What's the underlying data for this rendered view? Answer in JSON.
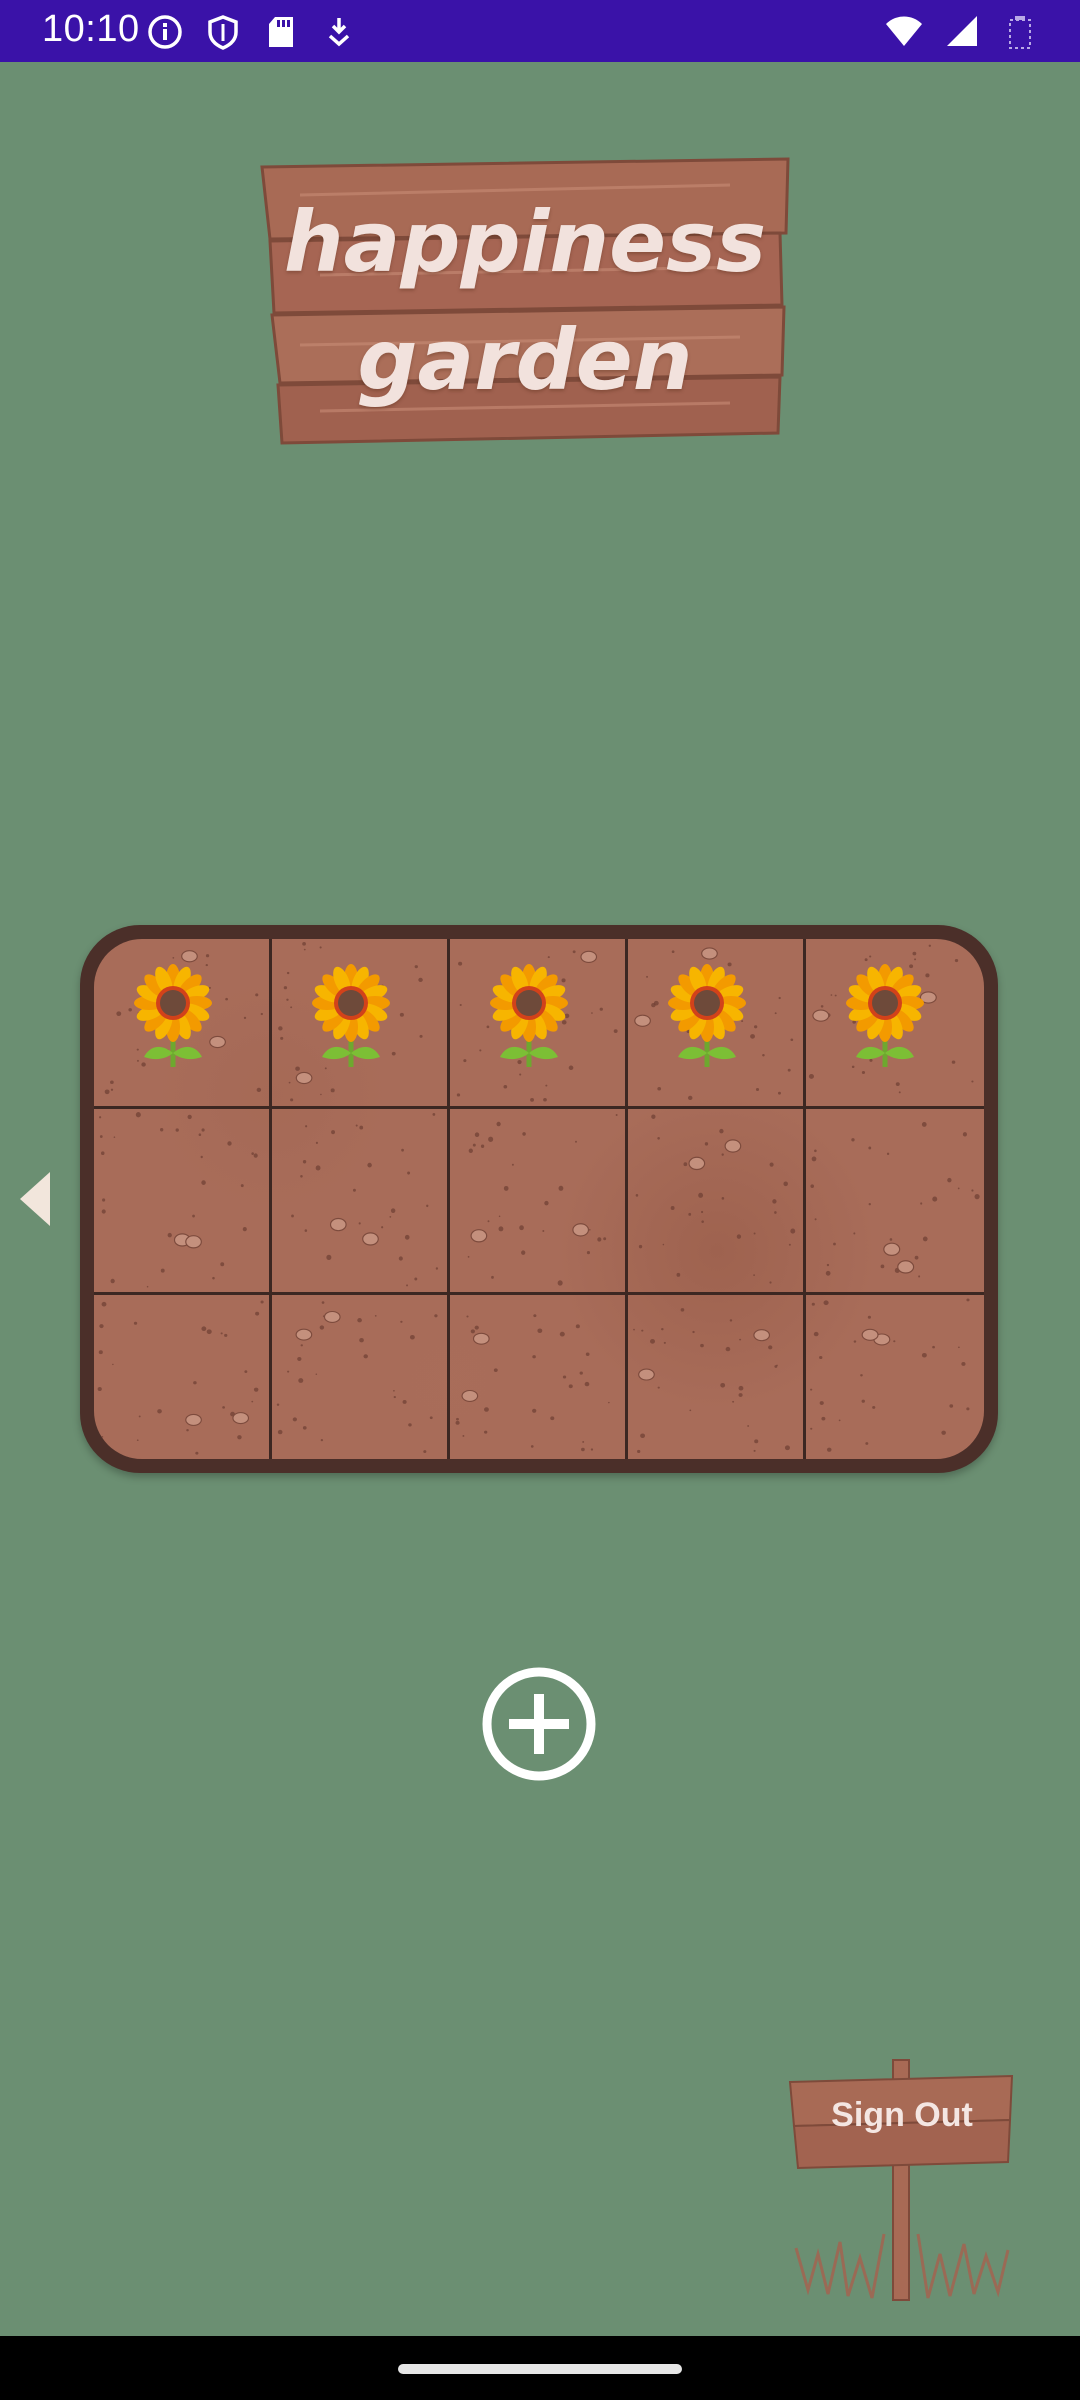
{
  "status_bar": {
    "time": "10:10",
    "left_icons": [
      "info-icon",
      "shield-icon",
      "sd-card-icon",
      "download-icon"
    ],
    "right_icons": [
      "wifi-icon",
      "cell-signal-icon",
      "battery-icon"
    ]
  },
  "title": {
    "line1": "happiness",
    "line2": "garden"
  },
  "garden": {
    "rows": 3,
    "columns": 5,
    "plants": [
      {
        "row": 1,
        "col": 1,
        "type": "sunflower"
      },
      {
        "row": 1,
        "col": 2,
        "type": "sunflower"
      },
      {
        "row": 1,
        "col": 3,
        "type": "sunflower"
      },
      {
        "row": 1,
        "col": 4,
        "type": "sunflower"
      },
      {
        "row": 1,
        "col": 5,
        "type": "sunflower"
      }
    ]
  },
  "add_button_icon": "add-circle-icon",
  "back_icon": "chevron-left-icon",
  "signout": {
    "label": "Sign Out"
  },
  "colors": {
    "background": "#6b8f72",
    "status_bar": "#3a12a8",
    "wood": "#a86a55",
    "soil": "#a86c59",
    "bed_border": "#4b2f29"
  }
}
